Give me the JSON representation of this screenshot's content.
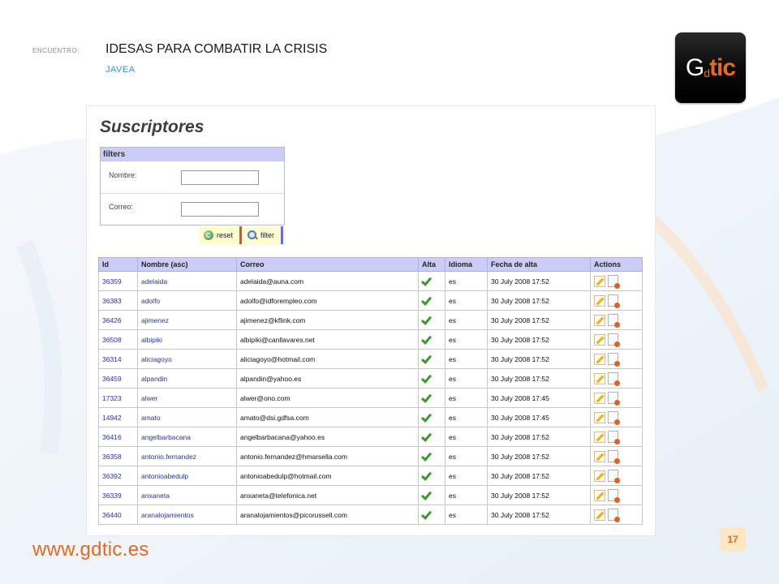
{
  "header": {
    "encuentro_label": "ENCUENTRO:",
    "title": "IDESAS PARA COMBATIR LA CRISIS",
    "subtitle": "JAVEA"
  },
  "logo": {
    "g": "G",
    "d": "d",
    "tic": "tic"
  },
  "app": {
    "page_title": "Suscriptores",
    "filters": {
      "heading": "filters",
      "nombre_label": "Nombre:",
      "nombre_value": "",
      "correo_label": "Correo:",
      "correo_value": "",
      "reset_label": "reset",
      "filter_label": "filter"
    },
    "table": {
      "headers": [
        "Id",
        "Nombre (asc)",
        "Correo",
        "Alta",
        "Idioma",
        "Fecha de alta",
        "Actions"
      ],
      "rows": [
        {
          "id": "36359",
          "nombre": "adelaida",
          "correo": "adelaida@auna.com",
          "idioma": "es",
          "fecha": "30 July 2008 17:52"
        },
        {
          "id": "36383",
          "nombre": "adolfo",
          "correo": "adolfo@idforempleo.com",
          "idioma": "es",
          "fecha": "30 July 2008 17:52"
        },
        {
          "id": "36426",
          "nombre": "ajimenez",
          "correo": "ajimenez@kflink.com",
          "idioma": "es",
          "fecha": "30 July 2008 17:52"
        },
        {
          "id": "36508",
          "nombre": "albipiki",
          "correo": "albipiki@canllavares.net",
          "idioma": "es",
          "fecha": "30 July 2008 17:52"
        },
        {
          "id": "36314",
          "nombre": "aliciagoyo",
          "correo": "aliciagoyo@hotmail.com",
          "idioma": "es",
          "fecha": "30 July 2008 17:52"
        },
        {
          "id": "36459",
          "nombre": "alpandin",
          "correo": "alpandin@yahoo.es",
          "idioma": "es",
          "fecha": "30 July 2008 17:52"
        },
        {
          "id": "17323",
          "nombre": "alwer",
          "correo": "alwer@ono.com",
          "idioma": "es",
          "fecha": "30 July 2008 17:45"
        },
        {
          "id": "14942",
          "nombre": "amato",
          "correo": "amato@dsi.gdfsa.com",
          "idioma": "es",
          "fecha": "30 July 2008 17:45"
        },
        {
          "id": "36416",
          "nombre": "angelbarbacana",
          "correo": "angelbarbacana@yahoo.es",
          "idioma": "es",
          "fecha": "30 July 2008 17:52"
        },
        {
          "id": "36358",
          "nombre": "antonio.fernandez",
          "correo": "antonio.fernandez@hmarsella.com",
          "idioma": "es",
          "fecha": "30 July 2008 17:52"
        },
        {
          "id": "36392",
          "nombre": "antonioabedulp",
          "correo": "antonioabedulp@hotmail.com",
          "idioma": "es",
          "fecha": "30 July 2008 17:52"
        },
        {
          "id": "36339",
          "nombre": "anxaneta",
          "correo": "anxaneta@telefonica.net",
          "idioma": "es",
          "fecha": "30 July 2008 17:52"
        },
        {
          "id": "36440",
          "nombre": "aranalojamientos",
          "correo": "aranalojamientos@picorussell.com",
          "idioma": "es",
          "fecha": "30 July 2008 17:52"
        }
      ]
    }
  },
  "footer": {
    "url": "www.gdtic.es",
    "page_number": "17"
  },
  "colors": {
    "accent": "#e56a1c",
    "table_header": "#ccccf8",
    "link": "#2435b8"
  }
}
